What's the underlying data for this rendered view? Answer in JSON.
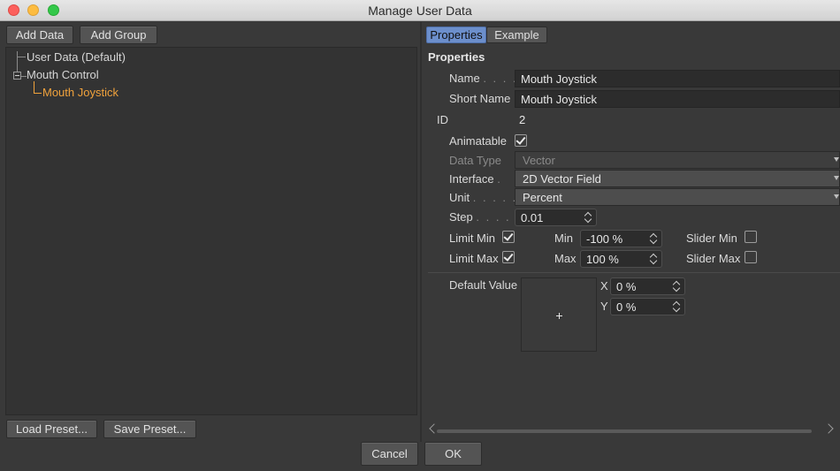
{
  "window": {
    "title": "Manage User Data"
  },
  "left": {
    "add_data": "Add Data",
    "add_group": "Add Group",
    "load_preset": "Load Preset...",
    "save_preset": "Save Preset...",
    "tree": [
      {
        "label": "User Data (Default)",
        "selected": false
      },
      {
        "label": "Mouth Control",
        "selected": false,
        "expanded": true
      },
      {
        "label": "Mouth Joystick",
        "selected": true
      }
    ]
  },
  "right": {
    "tabs": [
      "Properties",
      "Example"
    ],
    "section_title": "Properties",
    "name_label": "Name",
    "name_dots": ". . . .",
    "name_value": "Mouth Joystick",
    "short_name_label": "Short Name",
    "short_name_value": "Mouth Joystick",
    "id_label": "ID",
    "id_value": "2",
    "animatable_label": "Animatable",
    "animatable": true,
    "data_type_label": "Data Type",
    "data_type_value": "Vector",
    "interface_label": "Interface",
    "interface_dots": ".",
    "interface_value": "2D Vector Field",
    "unit_label": "Unit",
    "unit_dots": ". . . . .",
    "unit_value": "Percent",
    "step_label": "Step",
    "step_dots": ". . . .",
    "step_value": "0.01",
    "limit_min_label": "Limit Min",
    "limit_min": true,
    "min_label": "Min",
    "min_value": "-100 %",
    "slider_min_label": "Slider Min",
    "slider_min": false,
    "limit_max_label": "Limit Max",
    "limit_max": true,
    "max_label": "Max",
    "max_value": "100 %",
    "slider_max_label": "Slider Max",
    "slider_max": false,
    "default_value_label": "Default Value",
    "x_label": "X",
    "x_value": "0 %",
    "y_label": "Y",
    "y_value": "0 %"
  },
  "footer": {
    "cancel": "Cancel",
    "ok": "OK"
  },
  "colors": {
    "selected_tree_item": "#f0a23c",
    "active_tab": "#6c8fcc"
  }
}
